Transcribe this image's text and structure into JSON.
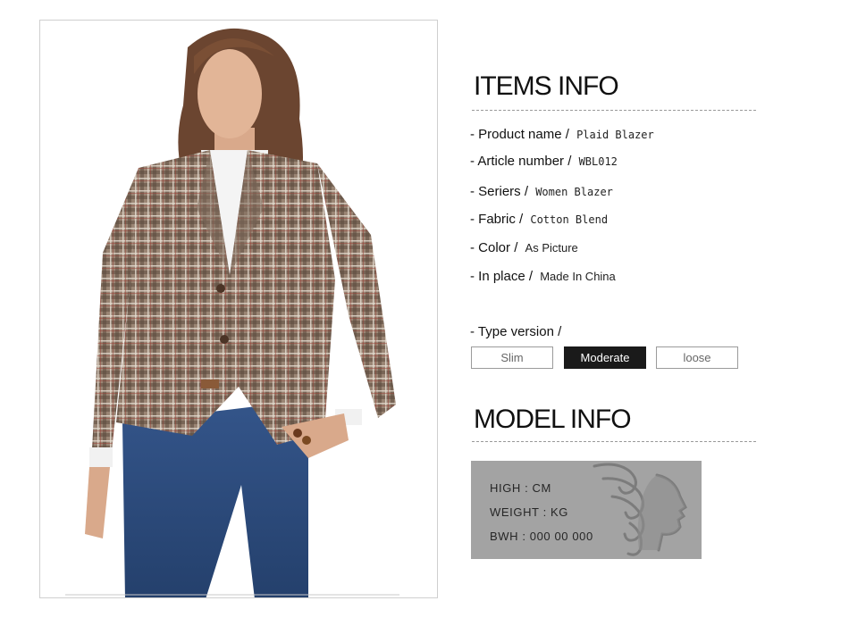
{
  "items_info": {
    "heading": "ITEMS INFO",
    "rows": [
      {
        "label": "- Product name",
        "sep": "/",
        "value": "Plaid Blazer"
      },
      {
        "label": "- Article number",
        "sep": "/",
        "value": "WBL012"
      },
      {
        "label": "- Seriers",
        "sep": "/",
        "value": "Women Blazer"
      },
      {
        "label": "- Fabric",
        "sep": "/",
        "value": "Cotton Blend"
      },
      {
        "label": "- Color",
        "sep": "/",
        "value": "As Picture"
      },
      {
        "label": "- In place",
        "sep": "/",
        "value": "Made In China"
      }
    ],
    "type_version": {
      "label": "- Type version /",
      "options": [
        "Slim",
        "Moderate",
        "loose"
      ],
      "selected": "Moderate"
    }
  },
  "model_info": {
    "heading": "MODEL INFO",
    "lines": [
      "HIGH : CM",
      "WEIGHT : KG",
      "BWH :  000  00  000"
    ]
  },
  "colors": {
    "selected_bg": "#1a1a1a",
    "model_box_bg": "#a3a3a3",
    "plaid_base": "#8c7766",
    "denim": "#2d4a78"
  },
  "photo": {
    "subject": "model-in-plaid-blazer"
  }
}
